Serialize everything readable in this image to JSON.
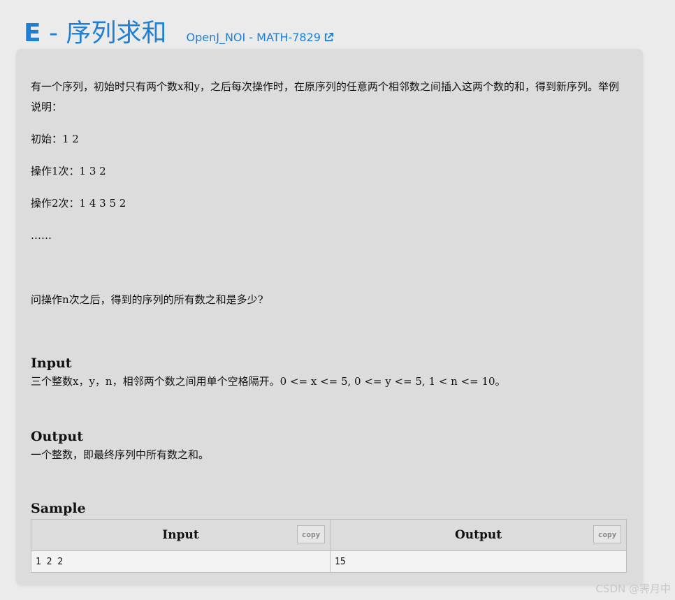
{
  "header": {
    "title_letter": "E",
    "title_rest": " - 序列求和",
    "source_link": "OpenJ_NOI - MATH-7829",
    "link_color": "#1e7fd6"
  },
  "problem": {
    "description": [
      "有一个序列，初始时只有两个数x和y，之后每次操作时，在原序列的任意两个相邻数之间插入这两个数的和，得到新序列。举例说明：",
      "初始：1 2",
      "操作1次：1 3 2",
      "操作2次：1 4 3 5 2",
      "……",
      "问操作n次之后，得到的序列的所有数之和是多少?"
    ],
    "input_heading": "Input",
    "input_text": "三个整数x，y，n，相邻两个数之间用单个空格隔开。0 <= x <= 5, 0 <= y <= 5, 1 < n <= 10。",
    "output_heading": "Output",
    "output_text": "一个整数，即最终序列中所有数之和。",
    "sample_heading": "Sample"
  },
  "sample": {
    "columns": [
      "Input",
      "Output"
    ],
    "copy_label": "copy",
    "rows": [
      [
        "1 2 2",
        "15"
      ]
    ]
  },
  "watermark": "CSDN @霁月中"
}
